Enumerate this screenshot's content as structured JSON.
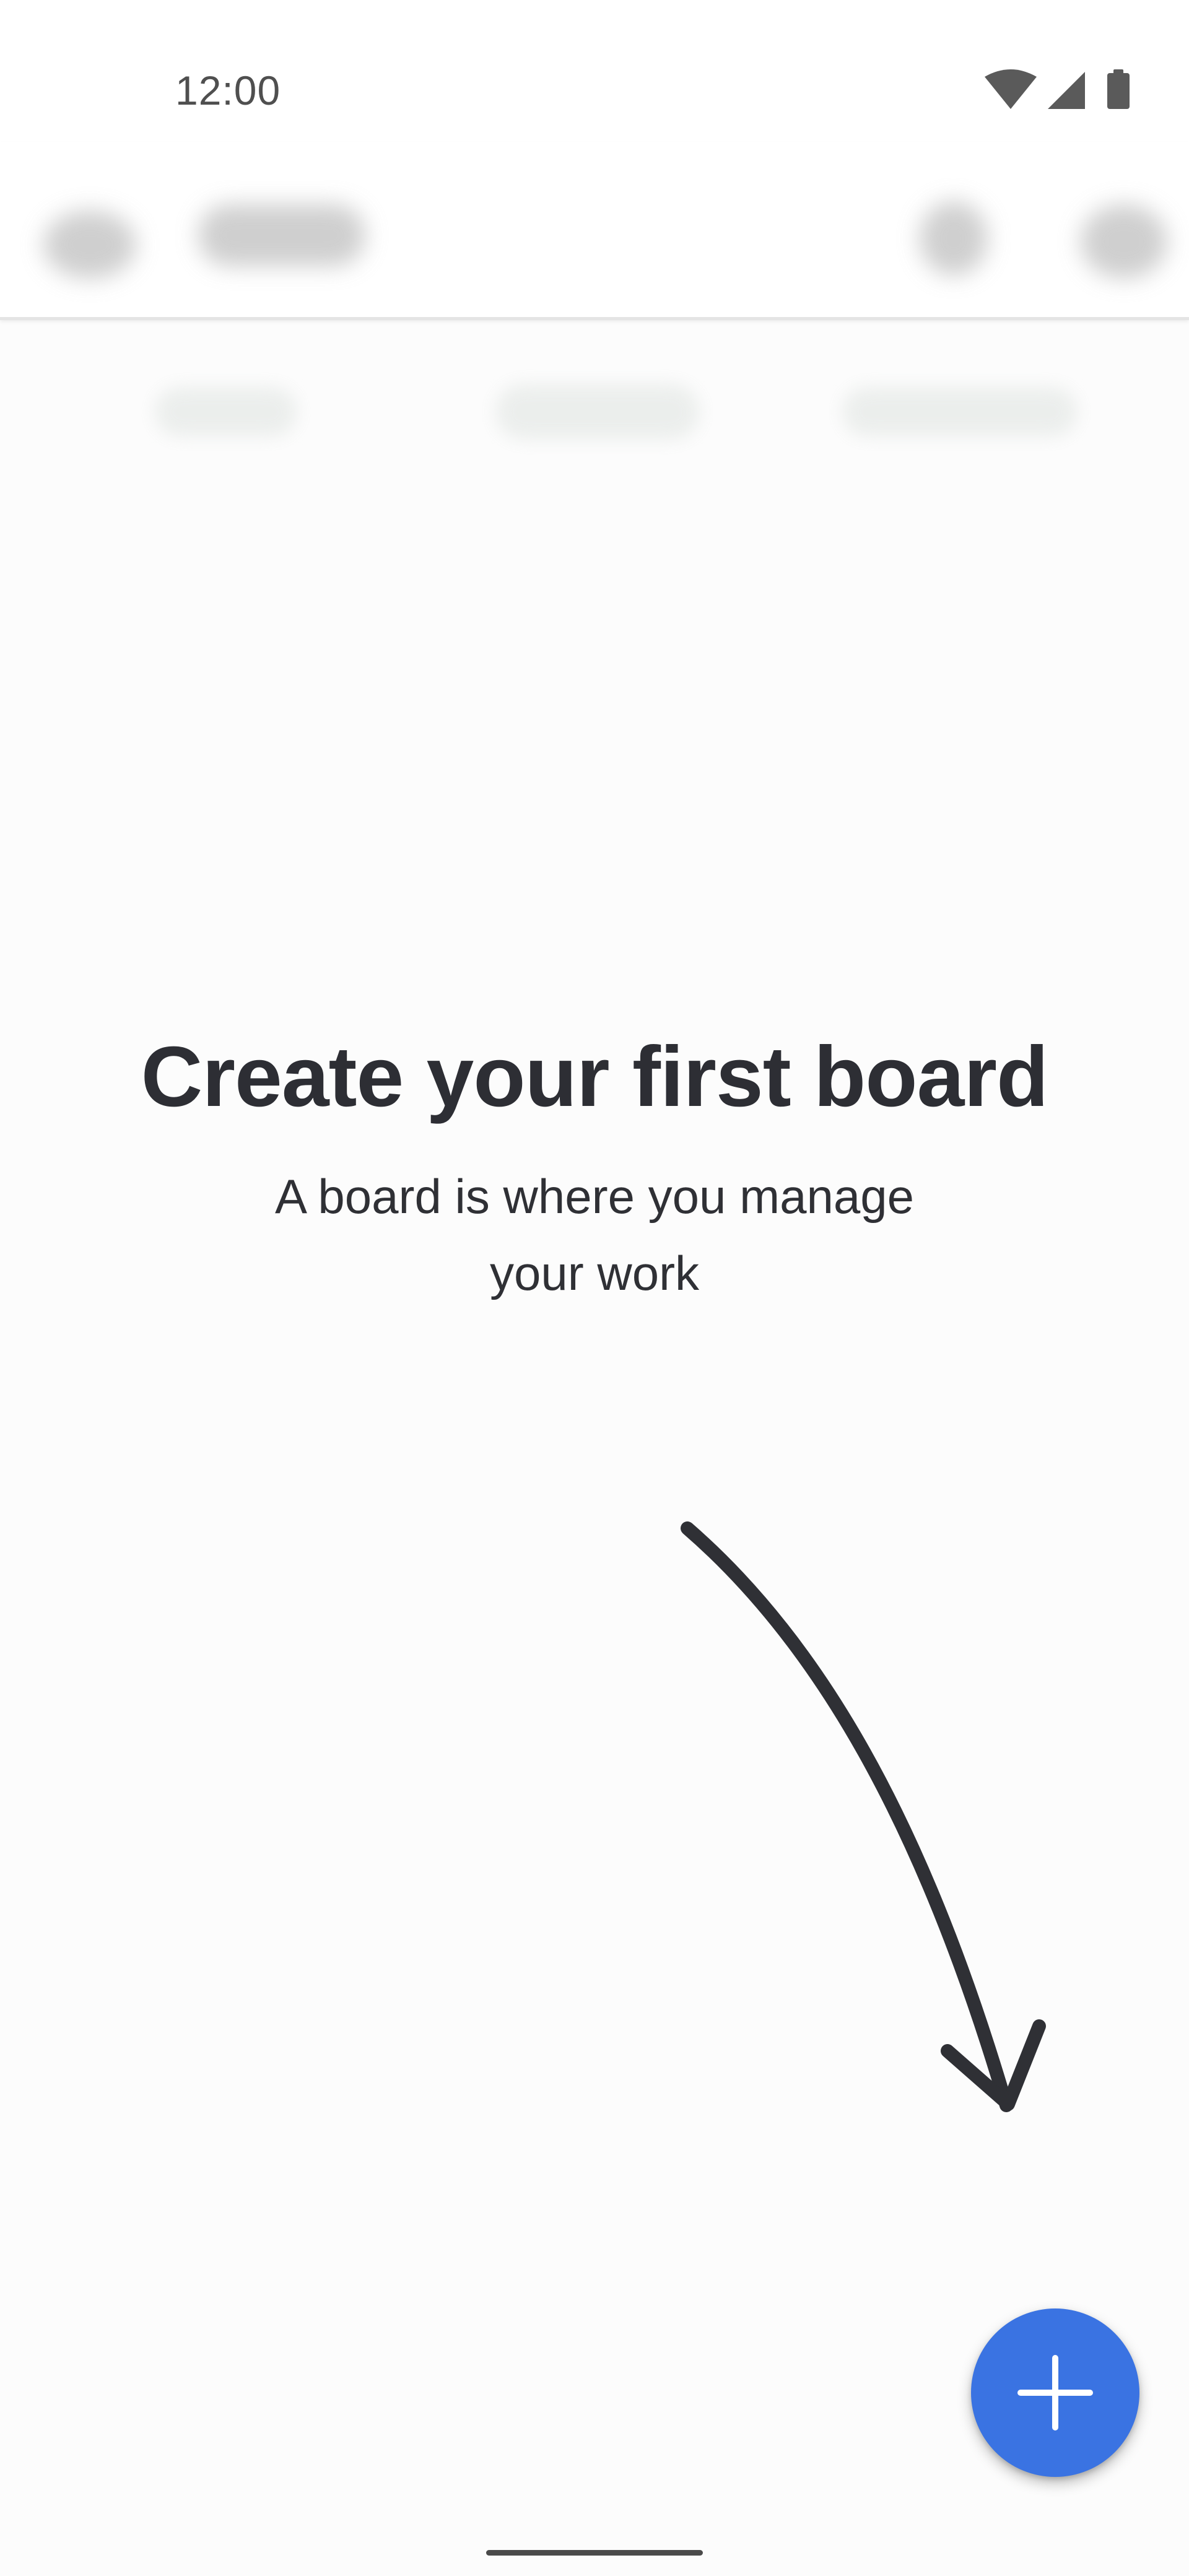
{
  "status_bar": {
    "time": "12:00",
    "icons": [
      "wifi-icon",
      "cellular-signal-icon",
      "battery-icon"
    ]
  },
  "app_bar": {
    "blurred": true,
    "icons": [
      "menu-icon",
      "logo-icon",
      "search-icon",
      "notifications-icon"
    ]
  },
  "tabs": {
    "blurred": true
  },
  "empty_state": {
    "title": "Create your first board",
    "subtitle_line1": "A board is where you manage",
    "subtitle_line2": "your work",
    "illustration": "curved-arrow-icon"
  },
  "fab": {
    "icon": "plus-icon",
    "color": "#3a73e2"
  },
  "colors": {
    "text_primary": "#2d2e34",
    "background": "#fcfcfc",
    "accent": "#3a73e2"
  }
}
